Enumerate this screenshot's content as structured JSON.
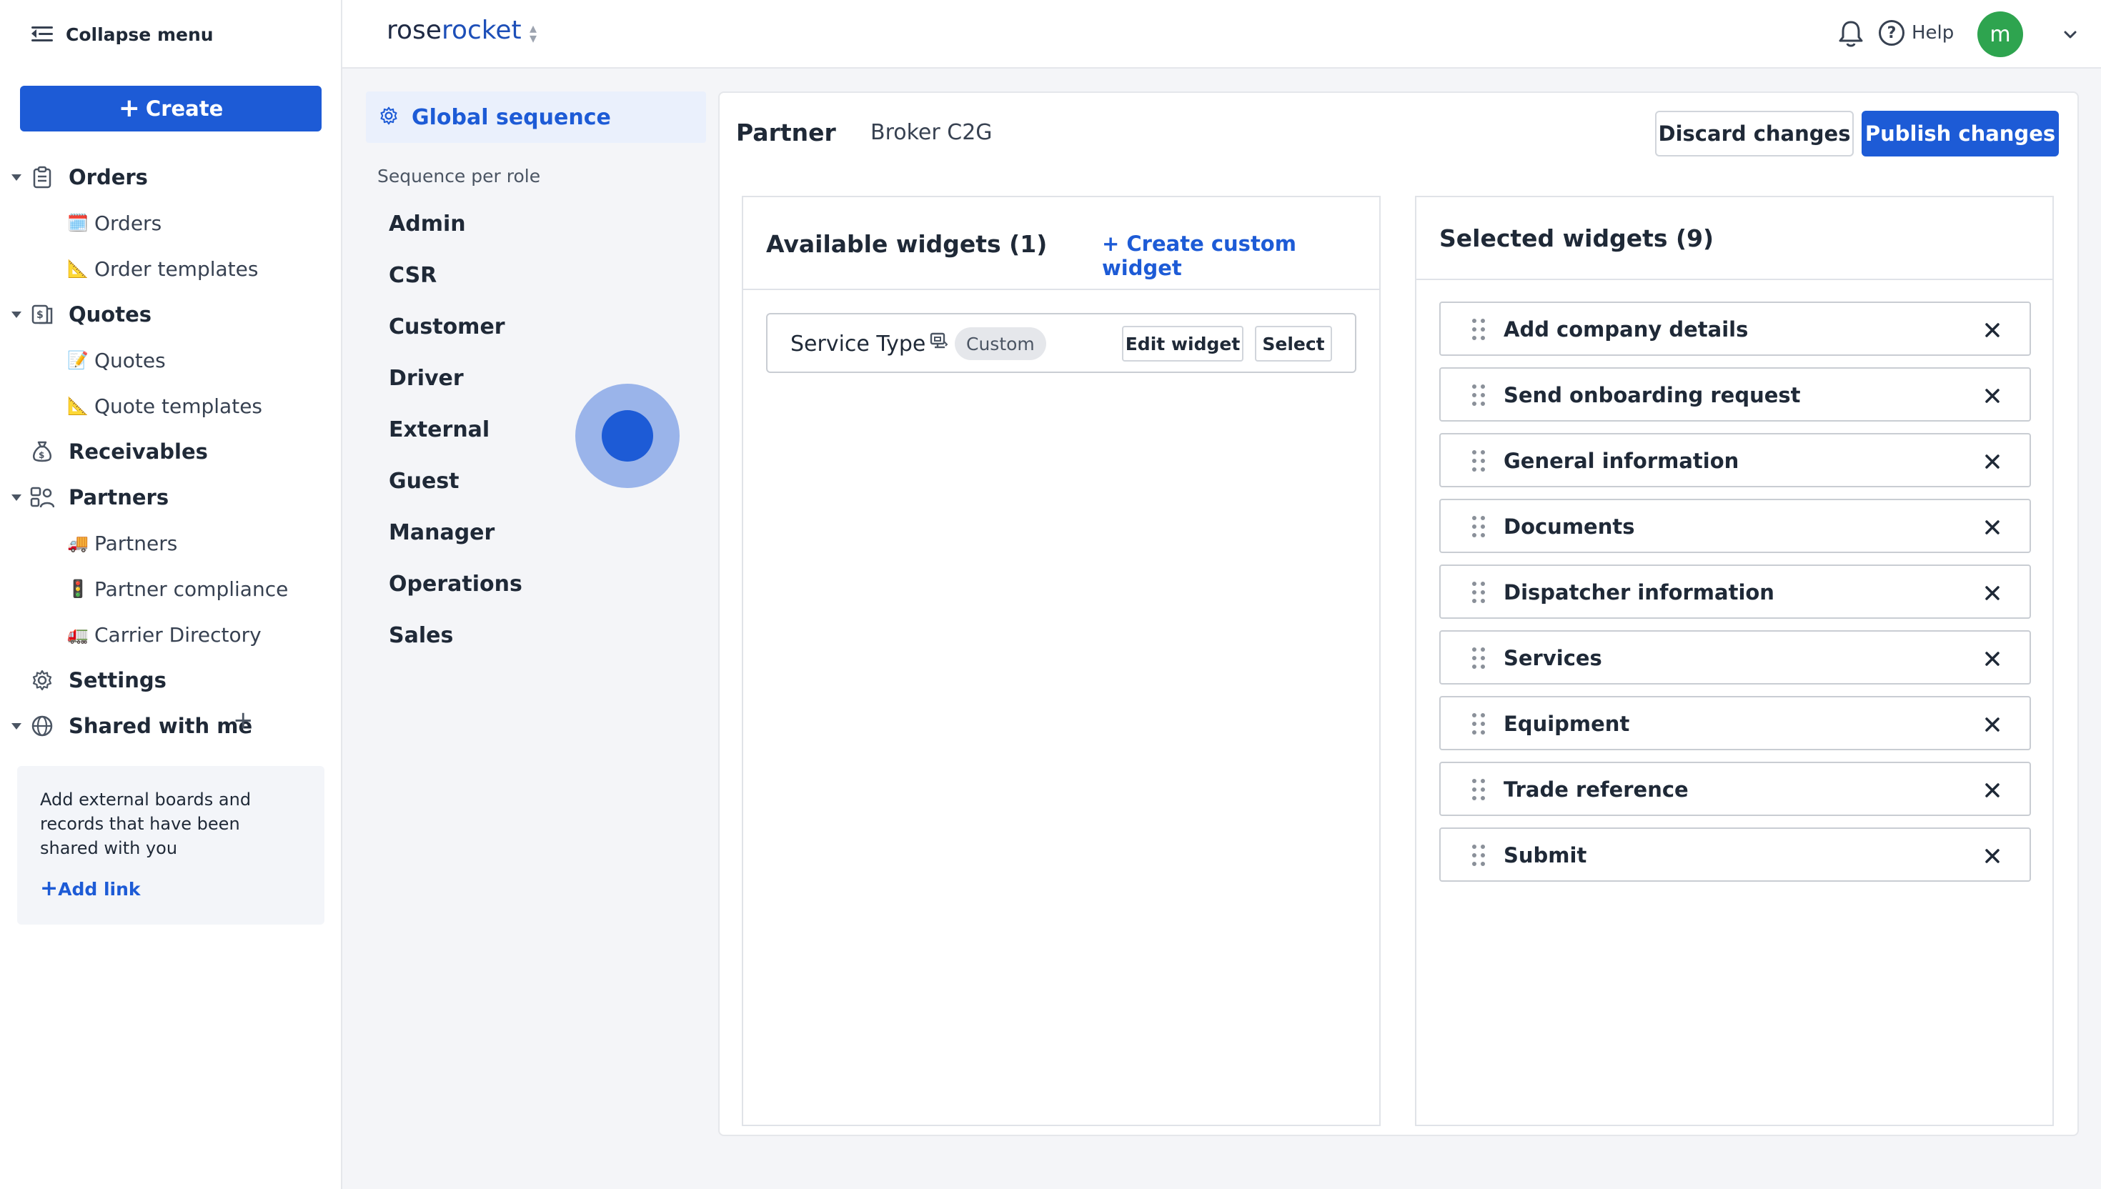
{
  "sidebar": {
    "collapse_label": "Collapse menu",
    "create_label": "Create",
    "sections": [
      {
        "label": "Orders",
        "sub": [
          {
            "emoji": "🗓️",
            "label": "Orders"
          },
          {
            "emoji": "📐",
            "label": "Order templates"
          }
        ]
      },
      {
        "label": "Quotes",
        "sub": [
          {
            "emoji": "📝",
            "label": "Quotes"
          },
          {
            "emoji": "📐",
            "label": "Quote templates"
          }
        ]
      },
      {
        "label": "Receivables"
      },
      {
        "label": "Partners",
        "sub": [
          {
            "emoji": "🚚",
            "label": "Partners"
          },
          {
            "emoji": "🚦",
            "label": "Partner compliance"
          },
          {
            "emoji": "🚛",
            "label": "Carrier Directory"
          }
        ]
      },
      {
        "label": "Settings"
      },
      {
        "label": "Shared with me"
      }
    ],
    "shared_box": {
      "text": "Add external boards and records that have been shared with you",
      "add_link": "Add link"
    }
  },
  "topbar": {
    "brand_part1": "rose",
    "brand_part2": "rocket",
    "help_label": "Help",
    "avatar_initial": "m"
  },
  "roles_panel": {
    "global_label": "Global sequence",
    "section_title": "Sequence per role",
    "roles": [
      "Admin",
      "CSR",
      "Customer",
      "Driver",
      "External",
      "Guest",
      "Manager",
      "Operations",
      "Sales"
    ]
  },
  "main": {
    "partner_label": "Partner",
    "partner_value": "Broker C2G",
    "discard_label": "Discard changes",
    "publish_label": "Publish changes",
    "available": {
      "title": "Available widgets (1)",
      "create_custom": "+ Create custom widget",
      "widgets": [
        {
          "name": "Service Type",
          "tag": "Custom",
          "edit_label": "Edit widget",
          "select_label": "Select"
        }
      ]
    },
    "selected": {
      "title": "Selected widgets (9)",
      "widgets": [
        "Add company details",
        "Send onboarding request",
        "General information",
        "Documents",
        "Dispatcher information",
        "Services",
        "Equipment",
        "Trade reference",
        "Submit"
      ]
    }
  },
  "colors": {
    "accent": "#1d5bd6",
    "avatar": "#2ea44f",
    "active_bg": "#eaf0fc"
  }
}
